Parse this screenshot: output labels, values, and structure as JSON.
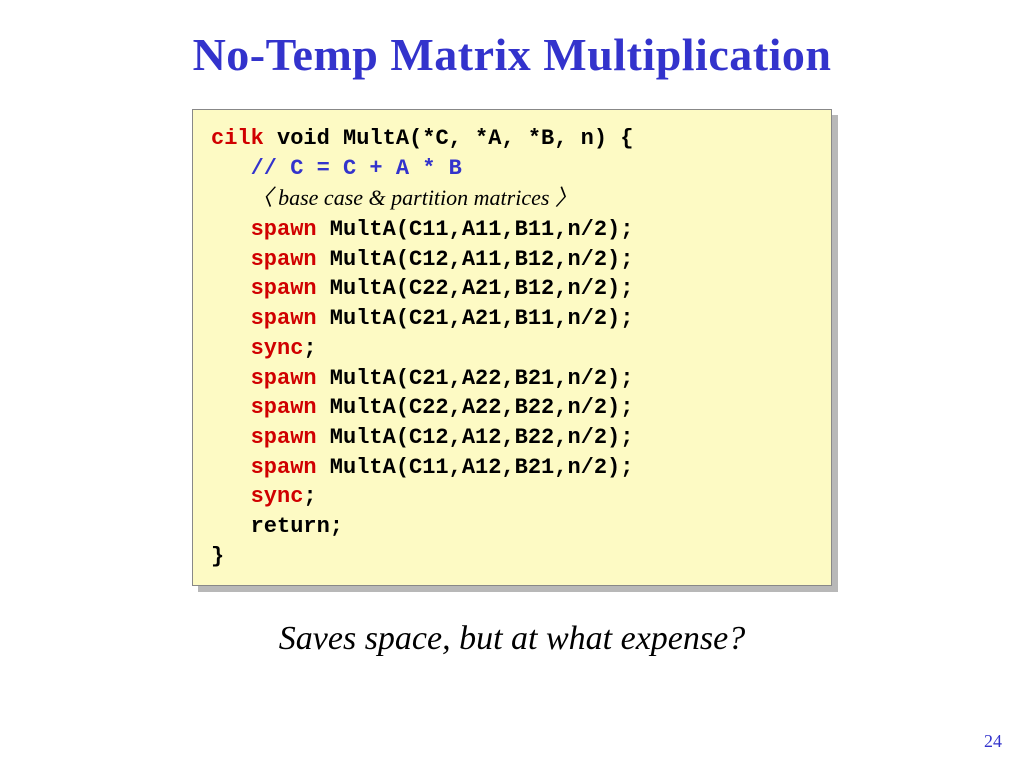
{
  "title": "No-Temp Matrix Multiplication",
  "code": {
    "sig_kw": "cilk",
    "sig_rest": " void MultA(*C, *A, *B, n) {",
    "comment": "// C = C + A * B",
    "note_open": "〈 ",
    "note_text": "base case & partition matrices",
    "note_close": " 〉",
    "spawn_kw": "spawn",
    "sync_kw": "sync",
    "call1": " MultA(C11,A11,B11,n/2);",
    "call2": " MultA(C12,A11,B12,n/2);",
    "call3": " MultA(C22,A21,B12,n/2);",
    "call4": " MultA(C21,A21,B11,n/2);",
    "call5": " MultA(C21,A22,B21,n/2);",
    "call6": " MultA(C22,A22,B22,n/2);",
    "call7": " MultA(C12,A12,B22,n/2);",
    "call8": " MultA(C11,A12,B21,n/2);",
    "semicolon": ";",
    "return_line": "return;",
    "close_brace": "}"
  },
  "caption": "Saves space, but at what expense?",
  "page_number": "24"
}
